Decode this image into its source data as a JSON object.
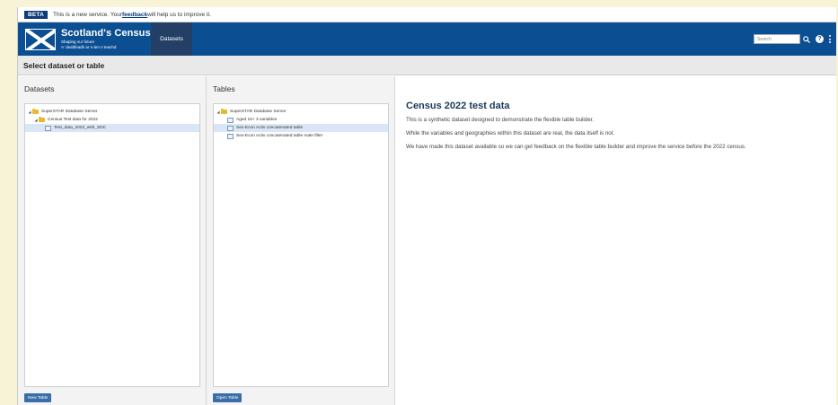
{
  "beta": {
    "tag": "BETA",
    "text_before": "This is a new service. Your ",
    "link": "feedback",
    "text_after": " will help us to improve it."
  },
  "header": {
    "logo_title": "Scotland's Census",
    "logo_sub1": "Shaping our future",
    "logo_sub2": "A' dealbhadh ar n-àm ri teachd",
    "nav_datasets": "Datasets",
    "search_placeholder": "Search",
    "help_label": "?"
  },
  "page_title": "Select dataset or table",
  "datasets": {
    "title": "Datasets",
    "tree": [
      {
        "label": "SuperSTAR Database Server",
        "type": "folder"
      },
      {
        "label": "Census Test data for 2022",
        "type": "folder"
      },
      {
        "label": "Test_data_2022_with_SDC",
        "type": "table"
      }
    ],
    "button": "New Table"
  },
  "tables": {
    "title": "Tables",
    "tree": [
      {
        "label": "SuperSTAR Database Server",
        "type": "folder"
      },
      {
        "label": "Aged 16+ 3 variables",
        "type": "table"
      },
      {
        "label": "Sex-Econ Activ concatenated table",
        "type": "table"
      },
      {
        "label": "Sex-Econ Activ concatenated table male filter",
        "type": "table"
      }
    ],
    "button": "Open Table"
  },
  "detail": {
    "heading": "Census 2022 test data",
    "p1": "This is a synthetic dataset designed to demonstrate the flexible table builder.",
    "p2": "While the variables and geographies within this dataset are real, the data itself is not.",
    "p3": "We have made this dataset available so we can get feedback on the flexible table builder and improve the service before the 2022 census."
  },
  "colors": {
    "header_bg": "#0b4f92",
    "beta_tag": "#0b3b78",
    "button_bg": "#3a6ea8",
    "page_bg": "#f8f3d6"
  }
}
